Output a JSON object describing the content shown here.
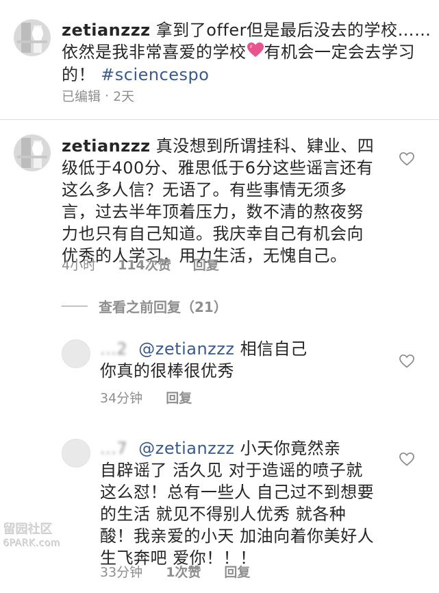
{
  "caption": {
    "username": "zetianzzz",
    "text": "拿到了offer但是最后没去的学校……依然是我非常喜爱的学校",
    "text_after_emoji": "有机会一定会去学习的！",
    "hashtag": "#sciencespo",
    "edited": "已编辑",
    "separator": "·",
    "time": "2天"
  },
  "comments": [
    {
      "username": "zetianzzz",
      "lines": [
        "真没想到所谓挂科、肄业、四",
        "级低于400分、雅思低于6分这些谣言还有",
        "这么多人信？无语了。有些事情无须多",
        "言，过去半年顶着压力，数不清的熬夜努",
        "力也只有自己知道。我庆幸自己有机会向",
        "优秀的人学习，用力生活，无愧自己。"
      ],
      "time": "4小时",
      "likes": "114次赞",
      "reply": "回复"
    }
  ],
  "view_previous": "查看之前回复（21）",
  "replies": [
    {
      "username_obscured": "...2",
      "mention": "@zetianzzz",
      "lines_first": "相信自己",
      "lines": [
        "你真的很棒很优秀"
      ],
      "time": "34分钟",
      "reply": "回复"
    },
    {
      "username_obscured": "...7",
      "mention": "@zetianzzz",
      "lines_first": "小天你竟然亲",
      "lines": [
        "自辟谣了 活久见 对于造谣的喷子就",
        "这么怼！总有一些人 自己过不到想要",
        "的生活 就见不得别人优秀 就各种",
        "酸！我亲爱的小天 加油向着你美好人",
        "生飞奔吧 爱你！！！"
      ],
      "time": "33分钟",
      "likes": "1次赞",
      "reply": "回复"
    }
  ],
  "watermark": {
    "chars": "留园社区",
    "site": "6PARK.com"
  },
  "colors": {
    "mention": "#3a5a8c",
    "meta": "#8e8e8e",
    "heart_emoji": "#e8558e"
  },
  "icons": {
    "like": "heart-outline-icon",
    "emoji": "pink-heart-emoji"
  }
}
